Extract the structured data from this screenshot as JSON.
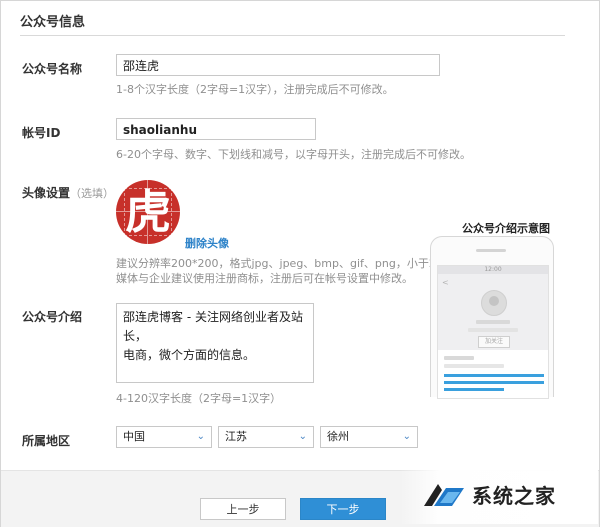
{
  "section": {
    "title": "公众号信息"
  },
  "name_row": {
    "label": "公众号名称",
    "value": "邵连虎",
    "hint": "1-8个汉字长度（2字母=1汉字），注册完成后不可修改。"
  },
  "account_row": {
    "label": "帐号ID",
    "value": "shaolianhu",
    "hint": "6-20个字母、数字、下划线和减号，以字母开头，注册完成后不可修改。"
  },
  "avatar_row": {
    "label": "头像设置",
    "optional": "（选填）",
    "avatar_char": "虎",
    "avatar_color": "#c7302a",
    "delete_link": "删除头像",
    "hint_line1": "建议分辨率200*200，格式jpg、jpeg、bmp、gif、png，小于2M",
    "hint_line2": "媒体与企业建议使用注册商标，注册后可在帐号设置中修改。"
  },
  "intro_row": {
    "label": "公众号介绍",
    "line1": "邵连虎博客 - 关注网络创业者及站长，",
    "line2": "电商，微个方面的信息。",
    "hint": "4-120汉字长度（2字母=1汉字）"
  },
  "region_row": {
    "label": "所属地区",
    "country": "中国",
    "province": "江苏",
    "city": "徐州"
  },
  "preview": {
    "title": "公众号介绍示意图",
    "status_time": "12:00",
    "follow_label": "加关注",
    "back_glyph": "<"
  },
  "buttons": {
    "prev": "上一步",
    "next": "下一步"
  },
  "watermark": {
    "text": "系统之家"
  },
  "colors": {
    "accent": "#2f8fd6",
    "link": "#2e83c9"
  }
}
